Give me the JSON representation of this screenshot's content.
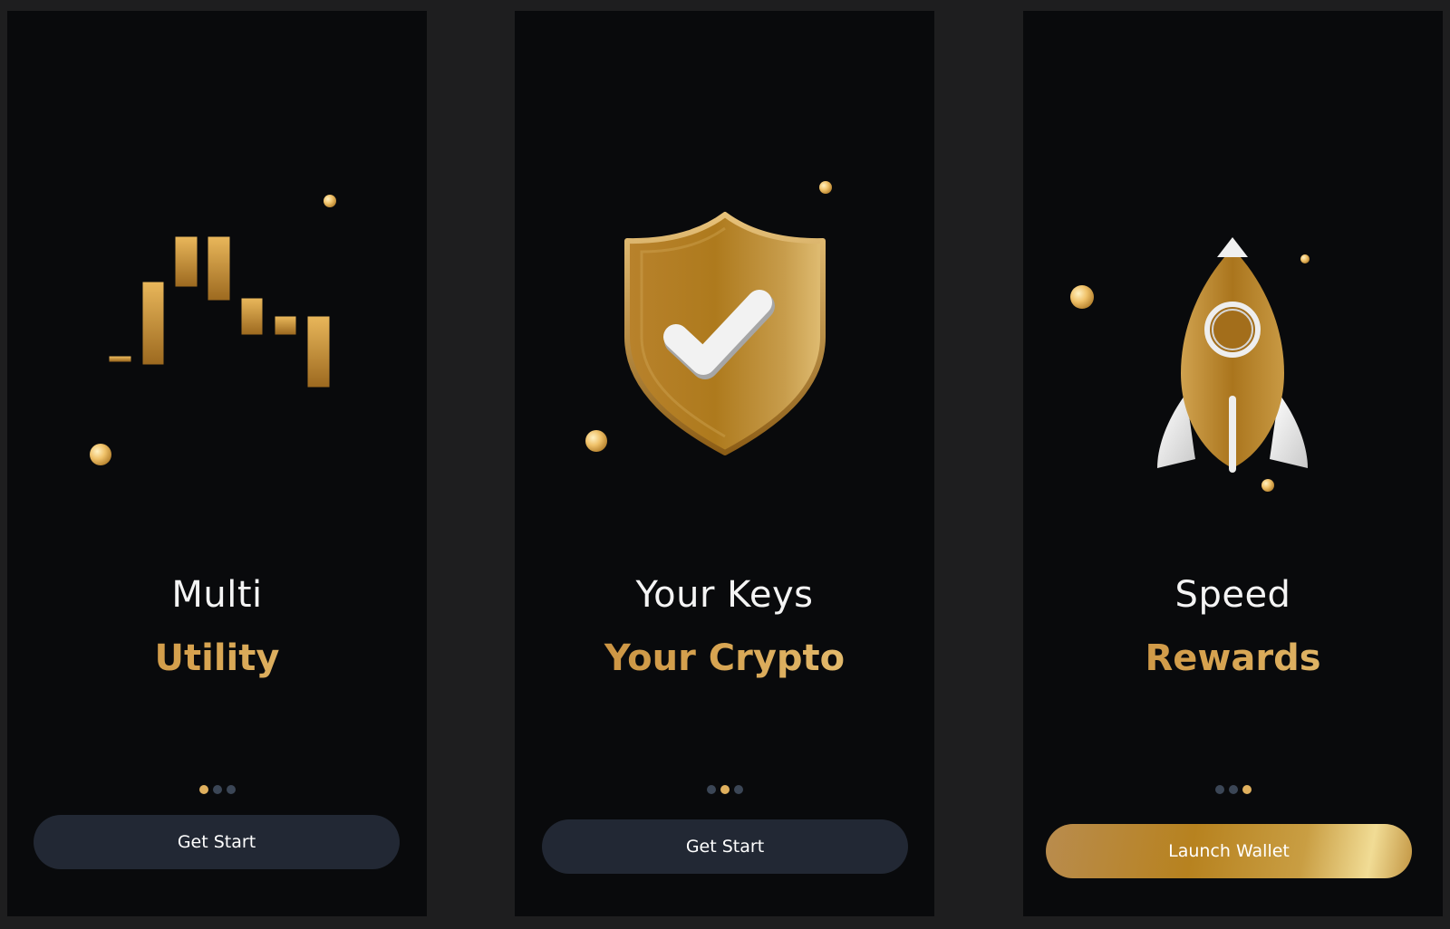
{
  "screens": [
    {
      "title_line1": "Multi",
      "title_line2": "Utility",
      "illustration": "candlestick-chart-icon",
      "pager": {
        "total": 3,
        "active": 1
      },
      "button_label": "Get Start"
    },
    {
      "title_line1": "Your Keys",
      "title_line2": "Your Crypto",
      "illustration": "shield-check-icon",
      "pager": {
        "total": 3,
        "active": 2
      },
      "button_label": "Get Start"
    },
    {
      "title_line1": "Speed",
      "title_line2": "Rewards",
      "illustration": "rocket-icon",
      "pager": {
        "total": 3,
        "active": 3
      },
      "button_label": "Launch Wallet"
    }
  ],
  "colors": {
    "page_background": "#1e1e1f",
    "screen_background": "#090a0c",
    "gold_accent": "#d6a24f",
    "dark_button": "#222834",
    "inactive_dot": "#3b4656"
  }
}
